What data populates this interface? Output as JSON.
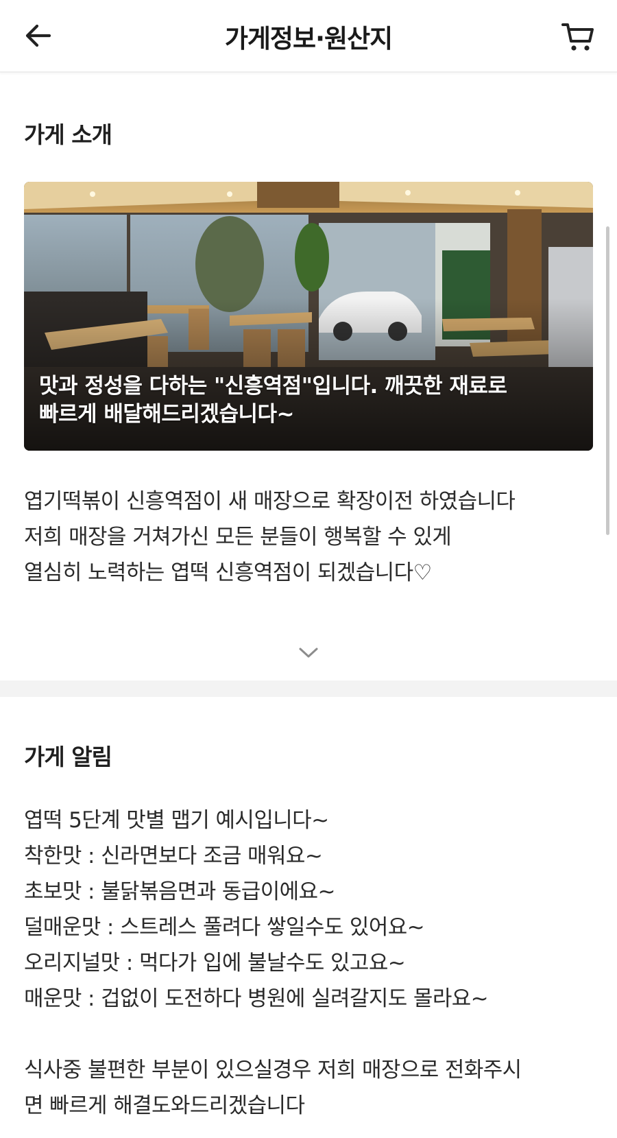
{
  "header": {
    "title": "가게정보·원산지",
    "back_icon": "arrow-left-icon",
    "cart_icon": "cart-icon"
  },
  "intro": {
    "section_title": "가게 소개",
    "photo_caption_lines": [
      "맛과 정성을 다하는 \"신흥역점\"입니다. 깨끗한 재료로",
      "빠르게 배달해드리겠습니다~"
    ],
    "text_lines": [
      "엽기떡볶이 신흥역점이 새 매장으로 확장이전 하였습니다",
      "저희 매장을 거쳐가신 모든 분들이 행복할 수 있게",
      "열심히 노력하는 엽떡 신흥역점이 되겠습니다♡"
    ],
    "expand_icon": "chevron-down-icon"
  },
  "notice": {
    "section_title": "가게 알림",
    "lines": [
      "엽떡 5단계 맛별 맵기 예시입니다~",
      "착한맛 :  신라면보다 조금 매워요~",
      "초보맛 :  불닭볶음면과 동급이에요~",
      "덜매운맛 :  스트레스 풀려다 쌓일수도 있어요~",
      "오리지널맛 : 먹다가 입에 불날수도 있고요~",
      "매운맛 :  겁없이 도전하다 병원에 실려갈지도 몰라요~",
      "",
      "식사중 불편한 부분이 있으실경우 저희 매장으로 전화주시",
      "면 빠르게 해결도와드리겠습니다"
    ]
  }
}
